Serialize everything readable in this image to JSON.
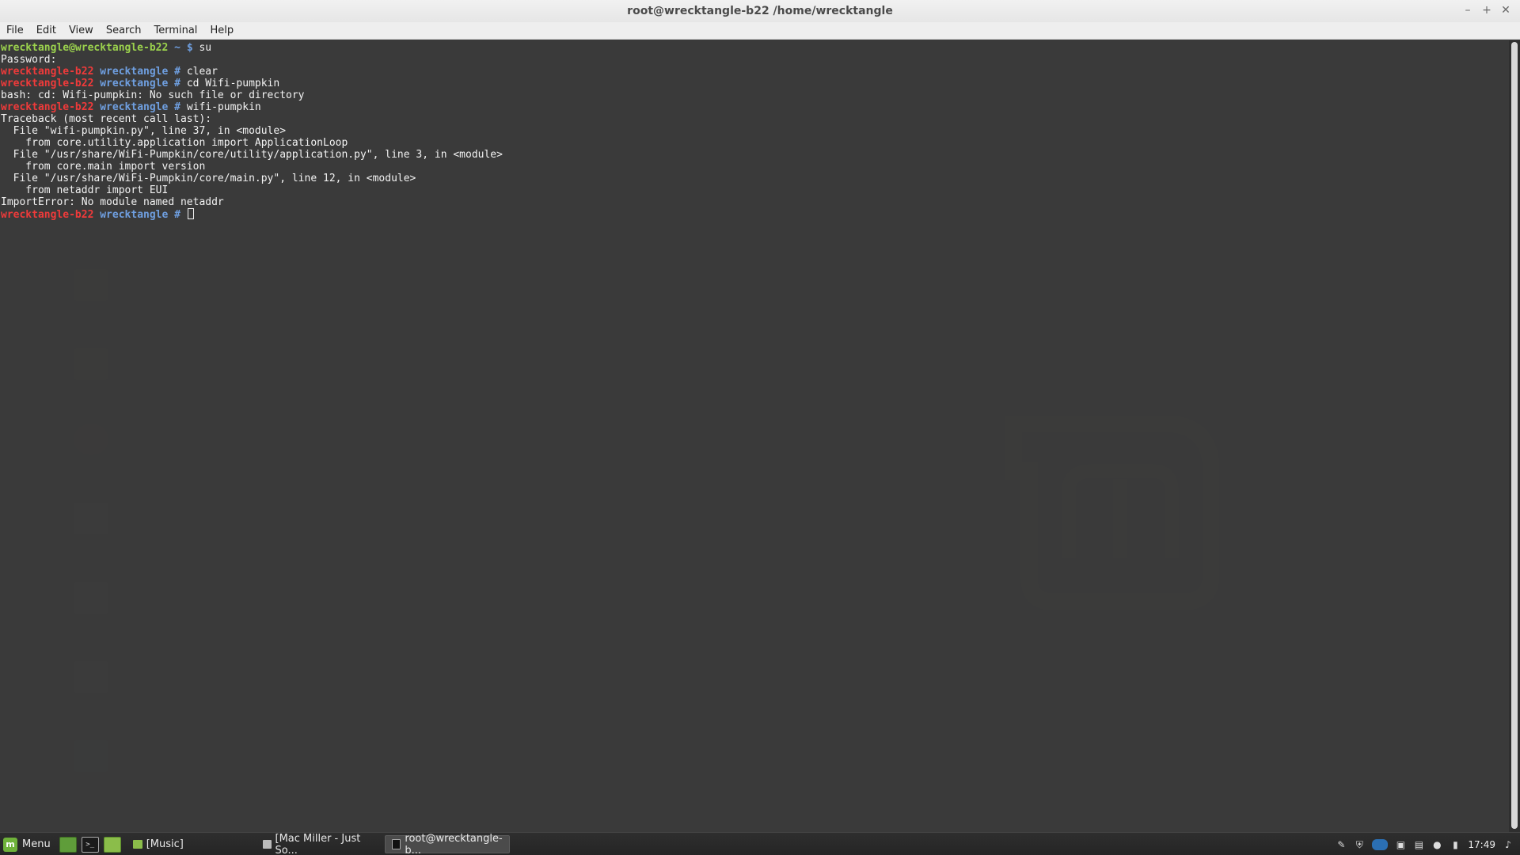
{
  "window": {
    "title": "root@wrecktangle-b22 /home/wrecktangle"
  },
  "menubar": {
    "items": [
      "File",
      "Edit",
      "View",
      "Search",
      "Terminal",
      "Help"
    ]
  },
  "terminal": {
    "user_host": "wrecktangle@wrecktangle-b22",
    "home_tilde": "~",
    "dollar": "$",
    "cmd_su": "su",
    "password_prompt": "Password:",
    "root_host": "wrecktangle-b22",
    "cwd": "wrecktangle",
    "hash": "#",
    "cmd_clear": "clear",
    "cmd_cd": "cd Wifi-pumpkin",
    "err_cd": "bash: cd: Wifi-pumpkin: No such file or directory",
    "cmd_run": "wifi-pumpkin",
    "tb_0": "Traceback (most recent call last):",
    "tb_1": "  File \"wifi-pumpkin.py\", line 37, in <module>",
    "tb_2": "    from core.utility.application import ApplicationLoop",
    "tb_3": "  File \"/usr/share/WiFi-Pumpkin/core/utility/application.py\", line 3, in <module>",
    "tb_4": "    from core.main import version",
    "tb_5": "  File \"/usr/share/WiFi-Pumpkin/core/main.py\", line 12, in <module>",
    "tb_6": "    from netaddr import EUI",
    "tb_7": "ImportError: No module named netaddr"
  },
  "taskbar": {
    "menu_label": "Menu",
    "tasks": [
      "[Music]",
      "[Mac Miller - Just So...",
      "root@wrecktangle-b..."
    ],
    "clock": "17:49"
  },
  "icons": {
    "minimize": "minimize-icon",
    "maximize": "maximize-icon",
    "close": "close-icon"
  }
}
